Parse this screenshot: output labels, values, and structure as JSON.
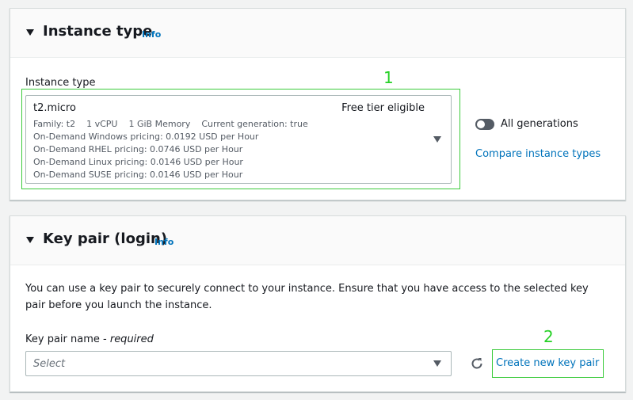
{
  "instance_type_panel": {
    "title": "Instance type",
    "info": "Info",
    "field_label": "Instance type",
    "annotation_number": "1",
    "selected": {
      "name": "t2.micro",
      "badge": "Free tier eligible",
      "family": "Family: t2",
      "vcpu": "1 vCPU",
      "memory": "1 GiB Memory",
      "generation": "Current generation: true",
      "pricing": [
        "On-Demand Windows pricing: 0.0192 USD per Hour",
        "On-Demand RHEL pricing: 0.0746 USD per Hour",
        "On-Demand Linux pricing: 0.0146 USD per Hour",
        "On-Demand SUSE pricing: 0.0146 USD per Hour"
      ]
    },
    "all_generations_label": "All generations",
    "all_generations_enabled": false,
    "compare_link": "Compare instance types"
  },
  "key_pair_panel": {
    "title": "Key pair (login)",
    "info": "Info",
    "description": "You can use a key pair to securely connect to your instance. Ensure that you have access to the selected key pair before you launch the instance.",
    "field_label_main": "Key pair name - ",
    "field_label_required": "required",
    "select_placeholder": "Select",
    "create_link": "Create new key pair",
    "annotation_number": "2"
  },
  "colors": {
    "link": "#0073bb",
    "annotation_green": "#27d127",
    "page_bg": "#f2f3f3"
  }
}
